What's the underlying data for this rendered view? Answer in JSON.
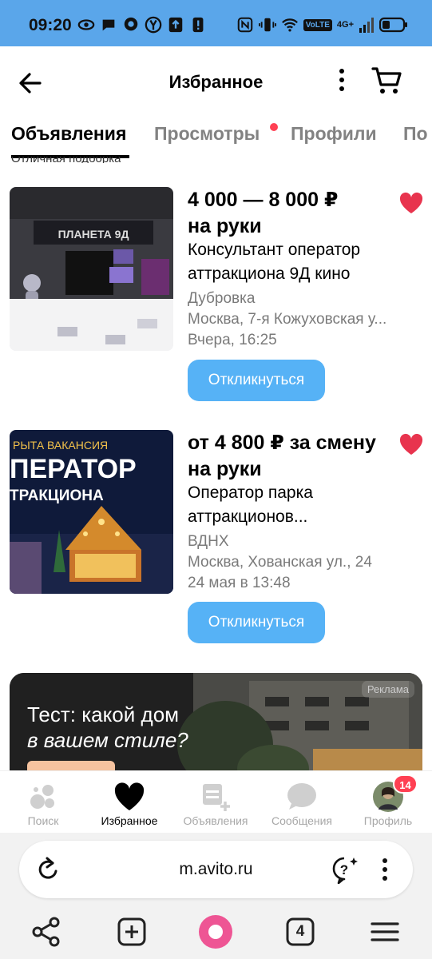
{
  "status_bar": {
    "time": "09:20",
    "network": "4G+",
    "volte": "VoLTE"
  },
  "header": {
    "title": "Избранное"
  },
  "tabs": [
    {
      "label": "Объявления"
    },
    {
      "label": "Просмотры"
    },
    {
      "label": "Профили"
    },
    {
      "label": "По"
    }
  ],
  "cut_text": "Отличная подборка",
  "listings": [
    {
      "price_line1": "4 000 — 8 000 ₽",
      "price_line2": "на руки",
      "title_line1": "Консультант оператор",
      "title_line2": "аттракциона 9Д кино",
      "metro": "Дубровка",
      "address": "Москва, 7-я Кожуховская у...",
      "date": "Вчера, 16:25",
      "image_text": "ПЛАНЕТА 9Д",
      "button": "Откликнуться"
    },
    {
      "price_line1": "от 4 800 ₽ за смену",
      "price_line2": "на руки",
      "title_line1": "Оператор парка",
      "title_line2": "аттракционов...",
      "metro": "ВДНХ",
      "address": "Москва, Хованская ул., 24",
      "date": "24 мая в 13:48",
      "image_text_1": "РЫТА ВАКАНСИЯ",
      "image_text_2": "ПЕРАТОР",
      "image_text_3": "ТРАКЦИОНА",
      "button": "Откликнуться"
    }
  ],
  "ad": {
    "line1": "Тест: какой дом",
    "line2": "в вашем стиле?",
    "badge": "Реклама"
  },
  "bottom_nav": [
    {
      "label": "Поиск"
    },
    {
      "label": "Избранное"
    },
    {
      "label": "Объявления"
    },
    {
      "label": "Сообщения"
    },
    {
      "label": "Профиль",
      "badge": "14"
    }
  ],
  "browser": {
    "url": "m.avito.ru",
    "tab_count": "4"
  },
  "colors": {
    "accent": "#56b2f6",
    "favorite": "#e8344e",
    "status_bar": "#5aa6ea"
  }
}
